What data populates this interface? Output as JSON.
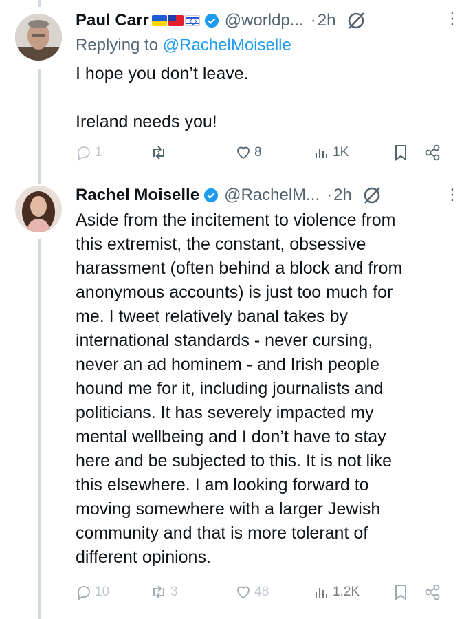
{
  "tweets": [
    {
      "name": "Paul Carr",
      "handle": "@worldp...",
      "dot": "·",
      "time": "2h",
      "replying_prefix": "Replying to ",
      "replying_handle": "@RachelMoiselle",
      "text": "I hope you don’t leave.\n\nIreland needs you!",
      "flags": [
        "ukraine-flag",
        "taiwan-flag",
        "israel-flag"
      ],
      "stats": {
        "replies": "1",
        "reposts": "",
        "likes": "8",
        "views": "1K"
      }
    },
    {
      "name": "Rachel Moiselle",
      "handle": "@RachelM...",
      "dot": "·",
      "time": "2h",
      "text": "Aside from the incitement to violence from\nthis extremist, the constant, obsessive\nharassment (often behind a block and from\nanonymous accounts) is just too much for\nme. I tweet relatively banal takes by\ninternational standards - never cursing,\nnever an ad hominem - and Irish people\nhound me for it, including journalists and\npoliticians. It has severely impacted my\nmental wellbeing and I don’t have to stay\nhere and be subjected to this. It is not like\nthis elsewhere. I am looking forward to\nmoving somewhere with a larger Jewish\ncommunity and that is more tolerant of\ndifferent opinions.",
      "stats": {
        "replies": "10",
        "reposts": "3",
        "likes": "48",
        "views": "1.2K"
      }
    }
  ],
  "colors": {
    "accent": "#1d9bf0",
    "muted": "#536471",
    "icon": "#8b98a5",
    "thread": "#cfd9de"
  }
}
